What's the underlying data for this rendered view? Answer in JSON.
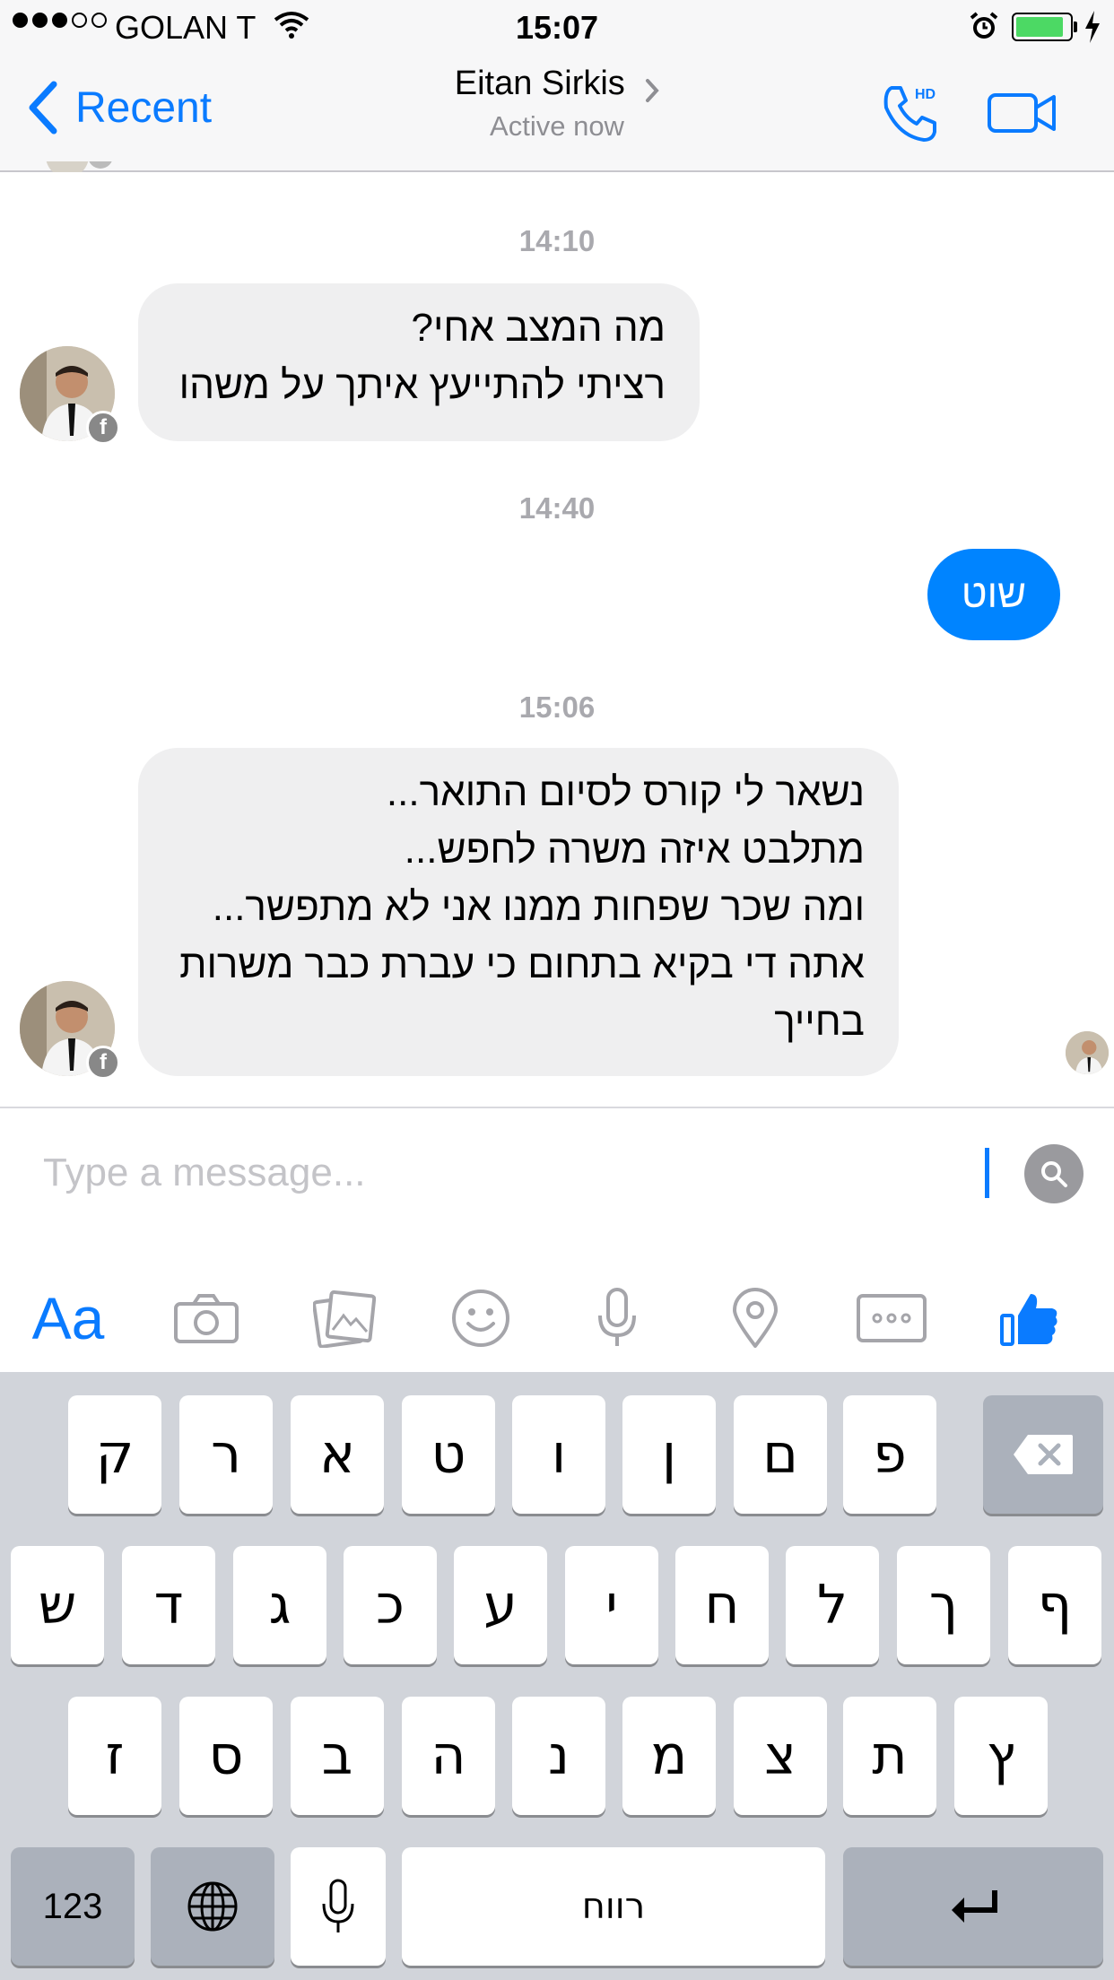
{
  "status_bar": {
    "carrier": "GOLAN T",
    "time": "15:07",
    "battery_level": 0.9,
    "signal_bars": 3,
    "signal_max": 5
  },
  "nav": {
    "back_label": "Recent",
    "contact_name": "Eitan Sirkis",
    "contact_status": "Active now",
    "call_badge": "HD",
    "accent_color": "#0a7bff"
  },
  "messages": [
    {
      "type": "timestamp",
      "text": "14:10"
    },
    {
      "type": "incoming",
      "lines": [
        "מה המצב אחי?",
        "רציתי להתייעץ איתך על משהו"
      ]
    },
    {
      "type": "timestamp",
      "text": "14:40"
    },
    {
      "type": "outgoing",
      "text": "שוט"
    },
    {
      "type": "timestamp",
      "text": "15:06"
    },
    {
      "type": "incoming",
      "lines": [
        "נשאר לי קורס לסיום התואר...",
        "מתלבט איזה משרה לחפש...",
        "ומה שכר שפחות ממנו אני לא מתפשר...",
        "אתה די בקיא בתחום כי עברת כבר משרות",
        "בחייך"
      ]
    }
  ],
  "composer": {
    "placeholder": "Type a message...",
    "text_format_label": "Aa"
  },
  "toolbar_icons": [
    "text-format-icon",
    "camera-icon",
    "photo-icon",
    "emoji-icon",
    "microphone-icon",
    "location-icon",
    "more-icon",
    "like-icon"
  ],
  "keyboard": {
    "row1": [
      "ק",
      "ר",
      "א",
      "ט",
      "ו",
      "ן",
      "ם",
      "פ"
    ],
    "row2": [
      "ש",
      "ד",
      "ג",
      "כ",
      "ע",
      "י",
      "ח",
      "ל",
      "ך",
      "ף"
    ],
    "row3": [
      "ז",
      "ס",
      "ב",
      "ה",
      "נ",
      "מ",
      "צ",
      "ת",
      "ץ"
    ],
    "numbers_label": "123",
    "space_label": "רווח"
  }
}
